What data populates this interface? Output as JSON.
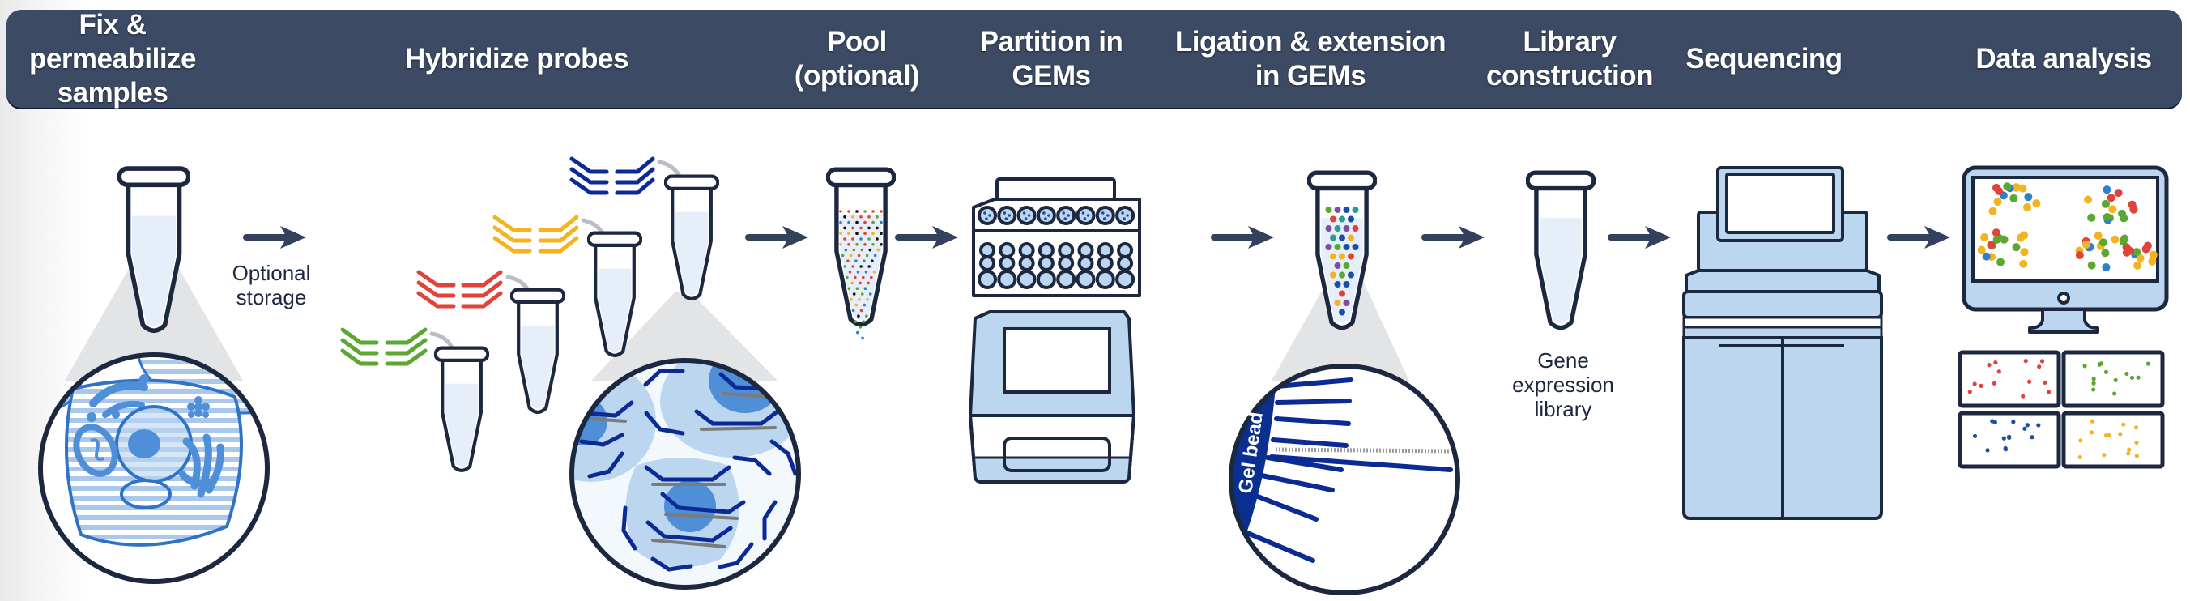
{
  "header": {
    "steps": [
      {
        "label": "Fix & permeabilize\nsamples"
      },
      {
        "label": "Hybridize probes"
      },
      {
        "label": "Pool\n(optional)"
      },
      {
        "label": "Partition in\nGEMs"
      },
      {
        "label": "Ligation & extension\nin GEMs"
      },
      {
        "label": "Library\nconstruction"
      },
      {
        "label": "Sequencing"
      },
      {
        "label": "Data analysis"
      }
    ]
  },
  "captions": {
    "optional_storage": "Optional\nstorage",
    "gene_expression_library": "Gene\nexpression\nlibrary",
    "gel_bead": "Gel bead"
  },
  "icons": {
    "sample_tube": "microcentrifuge-tube-icon",
    "cell_zoom": "fixed-cell-magnified-icon",
    "probe_tubes": "probe-hybridization-tubes-icon",
    "pooled_tube": "pooled-sample-tube-icon",
    "chip": "microfluidic-chip-icon",
    "controller": "chromium-controller-icon",
    "gem_tube": "gem-emulsion-tube-icon",
    "gel_bead_zoom": "gel-bead-magnified-icon",
    "library_tube": "library-tube-icon",
    "sequencer": "sequencer-instrument-icon",
    "monitor": "analysis-monitor-icon",
    "feature_plots": "feature-plot-panels-icon",
    "arrow": "arrow-right-icon"
  },
  "colors": {
    "header_bg": "#3c4a64",
    "outline": "#1c2740",
    "light_blue": "#bcd6f0",
    "liquid": "#e6eff9",
    "probe_green": "#5aa832",
    "probe_red": "#e0433a",
    "probe_yellow": "#f5b31e",
    "probe_blue": "#0b2a96",
    "dot_blue": "#2f7fcf",
    "dot_teal": "#2a9d8f",
    "dot_purple": "#7a4ea6"
  }
}
